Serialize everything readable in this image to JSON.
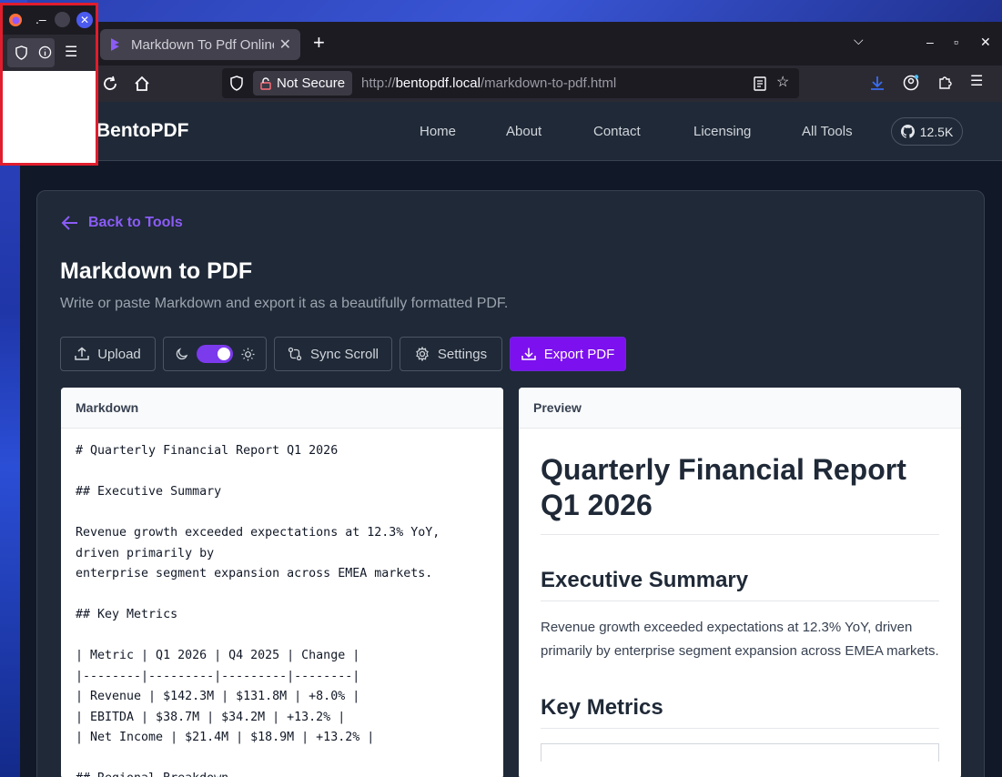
{
  "browser": {
    "tab_title": "Markdown To Pdf Online",
    "tab_close": "✕",
    "new_tab": "+",
    "tab_list": "⌵",
    "minimize": "–",
    "maximize": "▫",
    "close": "✕",
    "not_secure_label": "Not Secure",
    "url_scheme": "http://",
    "url_host": "bentopdf.local",
    "url_path": "/markdown-to-pdf.html"
  },
  "popup": {
    "title_text": ".–"
  },
  "site": {
    "brand": "BentoPDF",
    "nav": [
      "Home",
      "About",
      "Contact",
      "Licensing",
      "All Tools"
    ],
    "github_count": "12.5K"
  },
  "tool": {
    "back_label": "Back to Tools",
    "title": "Markdown to PDF",
    "subtitle": "Write or paste Markdown and export it as a beautifully formatted PDF.",
    "buttons": {
      "upload": "Upload",
      "sync_scroll": "Sync Scroll",
      "settings": "Settings",
      "export": "Export PDF"
    },
    "theme_toggle_on": true
  },
  "markdown_panel": {
    "header": "Markdown",
    "content": "# Quarterly Financial Report Q1 2026\n\n## Executive Summary\n\nRevenue growth exceeded expectations at 12.3% YoY,\ndriven primarily by\nenterprise segment expansion across EMEA markets.\n\n## Key Metrics\n\n| Metric | Q1 2026 | Q4 2025 | Change |\n|--------|---------|---------|--------|\n| Revenue | $142.3M | $131.8M | +8.0% |\n| EBITDA | $38.7M | $34.2M | +13.2% |\n| Net Income | $21.4M | $18.9M | +13.2% |\n\n## Regional Breakdown"
  },
  "preview_panel": {
    "header": "Preview",
    "h1": "Quarterly Financial Report Q1 2026",
    "h2_summary": "Executive Summary",
    "summary_text": "Revenue growth exceeded expectations at 12.3% YoY, driven primarily by enterprise segment expansion across EMEA markets.",
    "h2_metrics": "Key Metrics"
  }
}
